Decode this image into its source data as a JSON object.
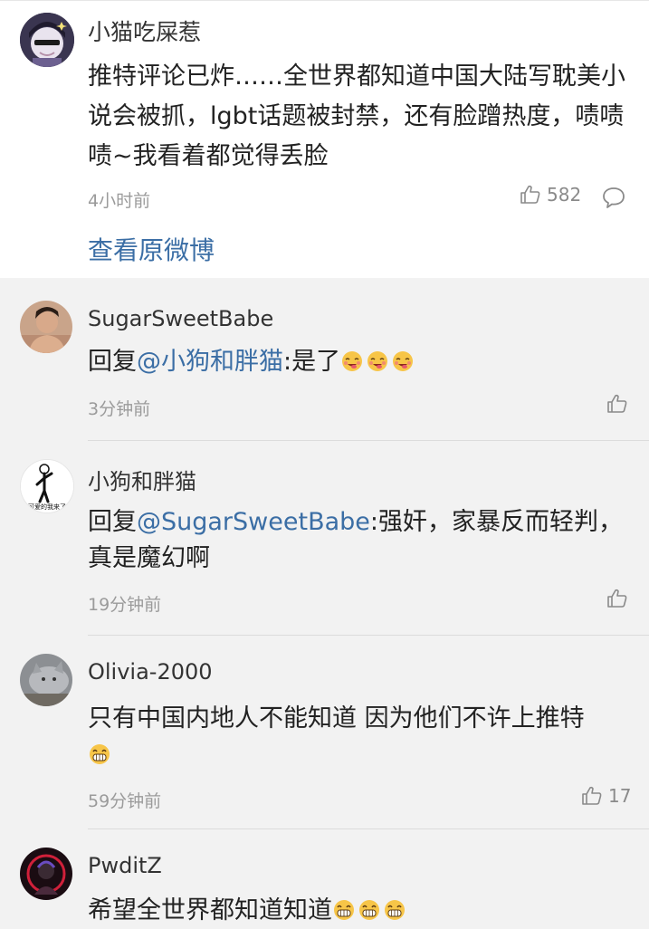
{
  "main_comment": {
    "username": "小猫吃屎惹",
    "text": "推特评论已炸……全世界都知道中国大陆写耽美小说会被抓，lgbt话题被封禁，还有脸蹭热度，啧啧啧~我看着都觉得丢脸",
    "time": "4小时前",
    "like_count": "582",
    "view_original_label": "查看原微博",
    "avatar_icon": "anime-avatar"
  },
  "replies": [
    {
      "username": "SugarSweetBabe",
      "reply_prefix": "回复",
      "mention": "@小狗和胖猫",
      "text": ":是了",
      "emoji": "yummy-emoji",
      "emoji_count": 3,
      "time": "3分钟前",
      "like_count": "",
      "avatar_icon": "man-photo-avatar"
    },
    {
      "username": "小狗和胖猫",
      "reply_prefix": "回复",
      "mention": "@SugarSweetBabe",
      "text": ":强奸，家暴反而轻判，真是魔幻啊",
      "time": "19分钟前",
      "like_count": "",
      "avatar_caption": "可爱的我来了",
      "avatar_icon": "stick-figure-avatar"
    },
    {
      "username": "Olivia-2000",
      "text": "只有中国内地人不能知道 因为他们不许上推特",
      "emoji": "grin-emoji",
      "emoji_count": 1,
      "time": "59分钟前",
      "like_count": "17",
      "avatar_icon": "cat-photo-avatar"
    },
    {
      "username": "PwditZ",
      "text": "希望全世界都知道知道",
      "emoji": "grin-emoji",
      "emoji_count": 3,
      "avatar_icon": "dark-portrait-avatar"
    }
  ],
  "colors": {
    "link": "#3b6ea5",
    "muted": "#9b9b9b",
    "card_bg": "#ffffff",
    "page_bg": "#f2f2f2"
  }
}
